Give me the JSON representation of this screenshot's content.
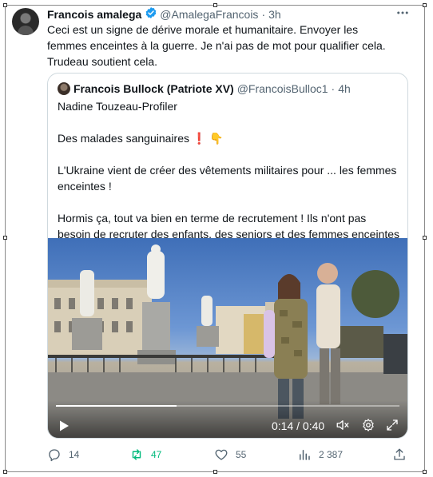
{
  "tweet": {
    "author_name": "Francois amalega",
    "author_handle": "@AmalegaFrancois",
    "separator": "·",
    "time": "3h",
    "text": "Ceci est un signe de dérive morale et humanitaire. Envoyer les femmes enceintes à la guerre. Je n'ai pas de mot pour qualifier cela. Trudeau soutient cela.",
    "more_icon": "more-horizontal-icon",
    "verified_icon": "verified-badge-icon",
    "verified_color": "#1d9bf0"
  },
  "quoted_tweet": {
    "author_name": "Francois Bullock (Patriote XV)",
    "author_handle": "@FrancoisBulloc1",
    "separator": "·",
    "time": "4h",
    "paragraphs": [
      "Nadine Touzeau-Profiler",
      "Des malades sanguinaires ❗ 👇",
      "L'Ukraine vient de créer des vêtements militaires pour ... les femmes enceintes !",
      "Hormis ça, tout va bien en terme de recrutement ! Ils n'ont pas besoin de recruter des enfants, des seniors et des femmes enceintes 🤡"
    ]
  },
  "video": {
    "current_time": "0:14",
    "duration": "0:40",
    "time_separator": " / ",
    "progress_fraction": 0.35,
    "icons": [
      "play-icon",
      "volume-muted-icon",
      "settings-icon",
      "fullscreen-icon"
    ]
  },
  "actions": {
    "replies": "14",
    "retweets": "47",
    "likes": "55",
    "views": "2 387",
    "retweet_color": "#00ba7c",
    "muted_color": "#536471"
  }
}
